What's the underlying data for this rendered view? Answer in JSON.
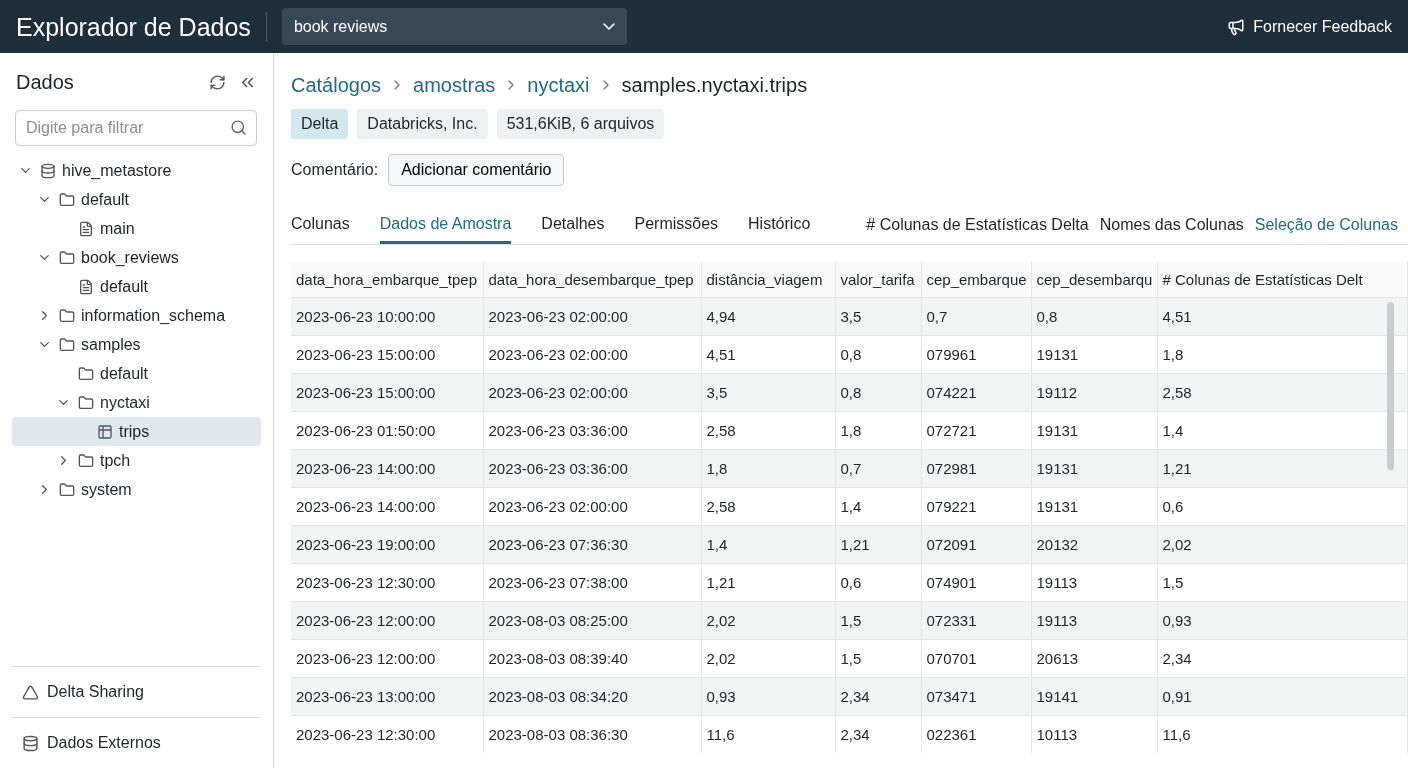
{
  "topbar": {
    "title": "Explorador de Dados",
    "dataset_select": {
      "value": "book reviews"
    },
    "feedback_button": "Fornecer Feedback"
  },
  "sidebar": {
    "title": "Dados",
    "filter": {
      "placeholder": "Digite para filtrar"
    },
    "tree": [
      {
        "label": "hive_metastore",
        "kind": "database",
        "expanded": true,
        "selected": false,
        "children": [
          {
            "label": "default",
            "kind": "folder",
            "expanded": true,
            "selected": false,
            "children": [
              {
                "label": "main",
                "kind": "file",
                "selected": false
              }
            ]
          },
          {
            "label": "book_reviews",
            "kind": "folder",
            "expanded": true,
            "selected": false,
            "children": [
              {
                "label": "default",
                "kind": "file",
                "selected": false
              }
            ]
          },
          {
            "label": "information_schema",
            "kind": "folder",
            "expanded": false,
            "selected": false
          },
          {
            "label": "samples",
            "kind": "folder",
            "expanded": true,
            "selected": false,
            "children": [
              {
                "label": "default",
                "kind": "folder",
                "selected": false
              },
              {
                "label": "nyctaxi",
                "kind": "folder",
                "expanded": true,
                "selected": false,
                "children": [
                  {
                    "label": "trips",
                    "kind": "table",
                    "selected": true
                  }
                ]
              },
              {
                "label": "tpch",
                "kind": "folder",
                "expanded": false,
                "selected": false
              }
            ]
          },
          {
            "label": "system",
            "kind": "folder",
            "expanded": false,
            "selected": false
          }
        ]
      }
    ],
    "footer_items": [
      {
        "label": "Delta Sharing",
        "kind": "sharing"
      },
      {
        "label": "Dados Externos",
        "kind": "database"
      }
    ]
  },
  "breadcrumb": [
    "Catálogos",
    "amostras",
    "nyctaxi",
    "samples.nyctaxi.trips"
  ],
  "badges": [
    {
      "label": "Delta",
      "kind": "primary"
    },
    {
      "label": "Databricks, Inc.",
      "kind": "plain"
    },
    {
      "label": "531,6KiB, 6 arquivos",
      "kind": "plain"
    }
  ],
  "comment": {
    "label": "Comentário:",
    "button": "Adicionar comentário"
  },
  "tabs": [
    {
      "label": "Colunas",
      "selected": false
    },
    {
      "label": "Dados de Amostra",
      "selected": true
    },
    {
      "label": "Detalhes",
      "selected": false
    },
    {
      "label": "Permissões",
      "selected": false
    },
    {
      "label": "Histórico",
      "selected": false
    }
  ],
  "table_options": [
    {
      "label": "# Colunas de Estatísticas Delta",
      "kind": "text"
    },
    {
      "label": "Nomes das Colunas",
      "kind": "text"
    },
    {
      "label": "Seleção de Colunas",
      "kind": "link"
    }
  ],
  "table": {
    "columns": [
      "data_hora_embarque_tpep",
      "data_hora_desembarque_tpep",
      "distância_viagem",
      "valor_tarifa",
      "cep_embarque",
      "cep_desembarqu",
      "# Colunas de Estatísticas Delt"
    ],
    "rows": [
      [
        "2023-06-23 10:00:00",
        "2023-06-23 02:00:00",
        "4,94",
        "3,5",
        "0,7",
        "0,8",
        "4,51"
      ],
      [
        "2023-06-23 15:00:00",
        "2023-06-23 02:00:00",
        "4,51",
        "0,8",
        "079961",
        "19131",
        "1,8"
      ],
      [
        "2023-06-23 15:00:00",
        "2023-06-23 02:00:00",
        "3,5",
        "0,8",
        "074221",
        "19112",
        "2,58"
      ],
      [
        "2023-06-23 01:50:00",
        "2023-06-23 03:36:00",
        "2,58",
        "1,8",
        "072721",
        "19131",
        "1,4"
      ],
      [
        "2023-06-23 14:00:00",
        "2023-06-23 03:36:00",
        "1,8",
        "0,7",
        "072981",
        "19131",
        "1,21"
      ],
      [
        "2023-06-23 14:00:00",
        "2023-06-23 02:00:00",
        "2,58",
        "1,4",
        "079221",
        "19131",
        "0,6"
      ],
      [
        "2023-06-23 19:00:00",
        "2023-06-23 07:36:30",
        "1,4",
        "1,21",
        "072091",
        "20132",
        "2,02"
      ],
      [
        "2023-06-23 12:30:00",
        "2023-06-23 07:38:00",
        "1,21",
        "0,6",
        "074901",
        "19113",
        "1,5"
      ],
      [
        "2023-06-23 12:00:00",
        "2023-08-03 08:25:00",
        "2,02",
        "1,5",
        "072331",
        "19113",
        "0,93"
      ],
      [
        "2023-06-23 12:00:00",
        "2023-08-03 08:39:40",
        "2,02",
        "1,5",
        "070701",
        "20613",
        "2,34"
      ],
      [
        "2023-06-23 13:00:00",
        "2023-08-03 08:34:20",
        "0,93",
        "2,34",
        "073471",
        "19141",
        "0,91"
      ],
      [
        "2023-06-23 12:30:00",
        "2023-08-03 08:36:30",
        "11,6",
        "2,34",
        "022361",
        "10113",
        "11,6"
      ]
    ]
  }
}
